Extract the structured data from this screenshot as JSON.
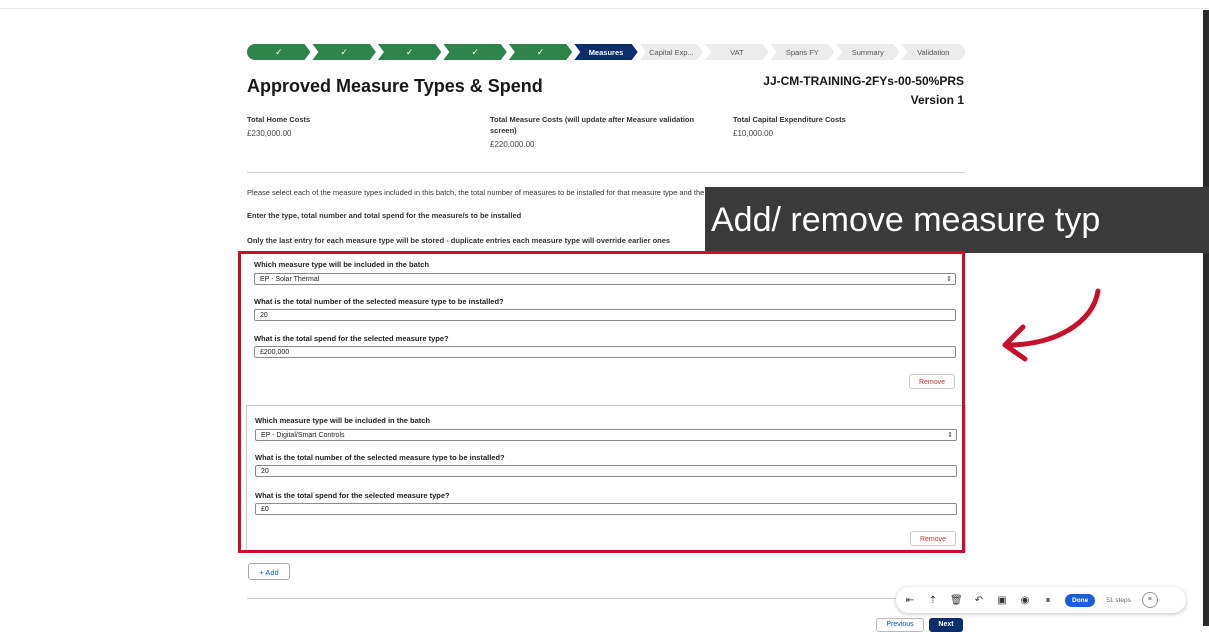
{
  "path": {
    "steps": [
      {
        "label": "✓",
        "state": "done"
      },
      {
        "label": "✓",
        "state": "done"
      },
      {
        "label": "✓",
        "state": "done"
      },
      {
        "label": "✓",
        "state": "done"
      },
      {
        "label": "✓",
        "state": "done"
      },
      {
        "label": "Measures",
        "state": "current"
      },
      {
        "label": "Capital Exp...",
        "state": "todo"
      },
      {
        "label": "VAT",
        "state": "todo"
      },
      {
        "label": "Spans FY",
        "state": "todo"
      },
      {
        "label": "Summary",
        "state": "todo"
      },
      {
        "label": "Validation",
        "state": "todo"
      }
    ]
  },
  "header": {
    "title": "Approved Measure Types & Spend",
    "ref_line1": "JJ-CM-TRAINING-2FYs-00-50%PRS",
    "ref_line2": "Version 1"
  },
  "costs": {
    "home_label": "Total Home Costs",
    "home_value": "£230,000.00",
    "measure_label": "Total Measure Costs (will update after Measure validation screen)",
    "measure_value": "£220,000.00",
    "capex_label": "Total Capital Expenditure Costs",
    "capex_value": "£10,000.00"
  },
  "instructions": {
    "line1": "Please select each of the measure types included in this batch, the total number of measures to be installed for that measure type and the total spend for that measure type.",
    "line2": "Enter the type, total number and total spend for the measure/s to be installed",
    "line3": "Only the last entry for each measure type will be stored - duplicate entries each measure type will override earlier ones"
  },
  "overlay": {
    "text": "Add/ remove measure typ"
  },
  "measures": [
    {
      "type_label": "Which measure type will be included in the batch",
      "type_value": "EP - Solar Thermal",
      "count_label": "What is the total number of the selected measure type to be installed?",
      "count_value": "20",
      "spend_label": "What is the total spend for the selected measure type?",
      "spend_value": "£200,000",
      "remove_label": "Remove"
    },
    {
      "type_label": "Which measure type will be included in the batch",
      "type_value": "EP - Digital/Smart Controls",
      "count_label": "What is the total number of the selected measure type to be installed?",
      "count_value": "20",
      "spend_label": "What is the total spend for the selected measure type?",
      "spend_value": "£0",
      "remove_label": "Remove"
    }
  ],
  "add_label": "+ Add",
  "toolbar": {
    "icons": [
      "skip-icon",
      "share-icon",
      "trash-icon",
      "undo-icon",
      "image-icon",
      "record-icon",
      "pause-icon"
    ],
    "icon_glyphs": [
      "⇤",
      "⇡",
      "🗑",
      "↶",
      "▣",
      "◉",
      "⏸"
    ],
    "done_label": "Done",
    "steps_label": "51 steps",
    "end_glyph": "≡"
  },
  "nav": {
    "previous_label": "Previous",
    "next_label": "Next"
  },
  "colors": {
    "success": "#2e844a",
    "brand": "#0b2e6b",
    "highlight": "#c8102e",
    "overlay": "#3a3a3a"
  }
}
